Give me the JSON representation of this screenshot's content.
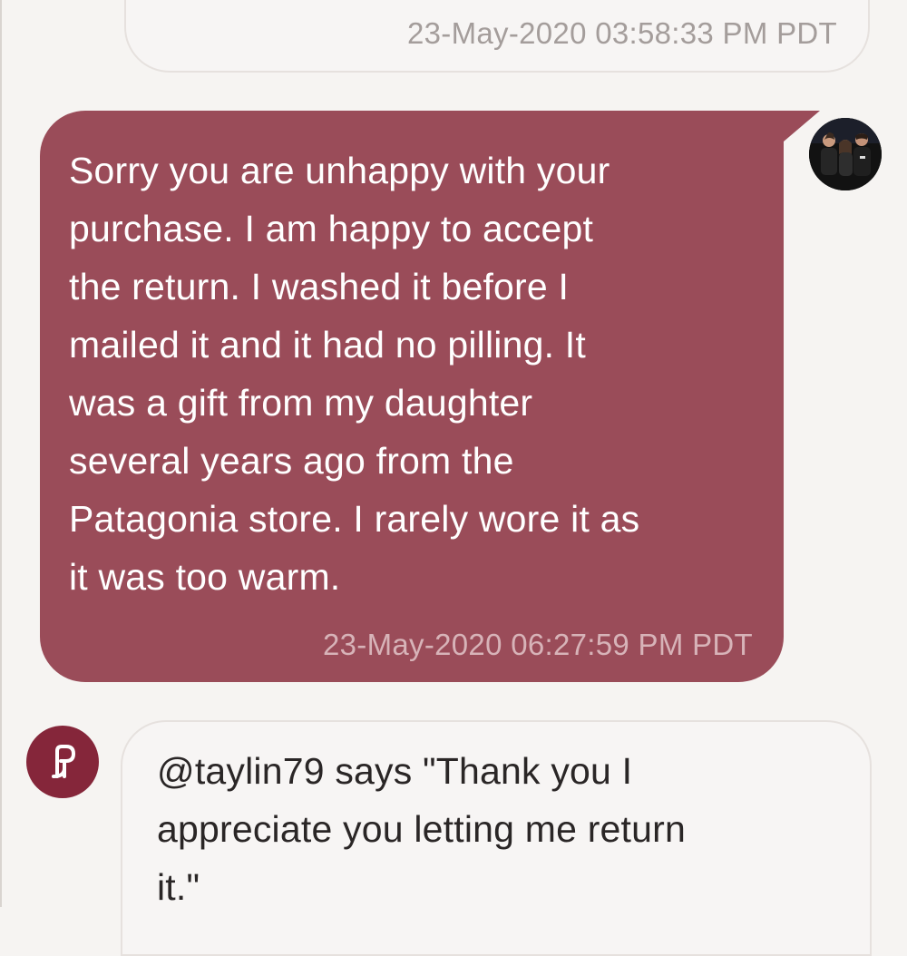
{
  "messages": [
    {
      "direction": "incoming",
      "timestamp": "23-May-2020 03:58:33 PM PDT"
    },
    {
      "direction": "outgoing",
      "text": "Sorry you are unhappy with your\npurchase. I am happy to accept\nthe return. I washed it before I\nmailed it and it had no pilling. It\nwas a gift from my daughter\nseveral years ago from the\nPatagonia store. I rarely wore it as\nit was too warm.",
      "timestamp": "23-May-2020 06:27:59 PM PDT"
    },
    {
      "direction": "incoming",
      "text": "@taylin79 says \"Thank you I\nappreciate you letting me return\nit.\""
    }
  ],
  "icons": {
    "sender_avatar": "user-avatar-photo",
    "system_avatar": "poshmark-logo-icon"
  },
  "colors": {
    "outgoing_bubble": "#9a4c59",
    "outgoing_text": "#ffffff",
    "outgoing_timestamp": "#d7b3b8",
    "incoming_bubble": "#f7f5f4",
    "incoming_text": "#2a2626",
    "timestamp_gray": "#a49d9b",
    "brand": "#85263a",
    "background": "#f6f4f2"
  }
}
